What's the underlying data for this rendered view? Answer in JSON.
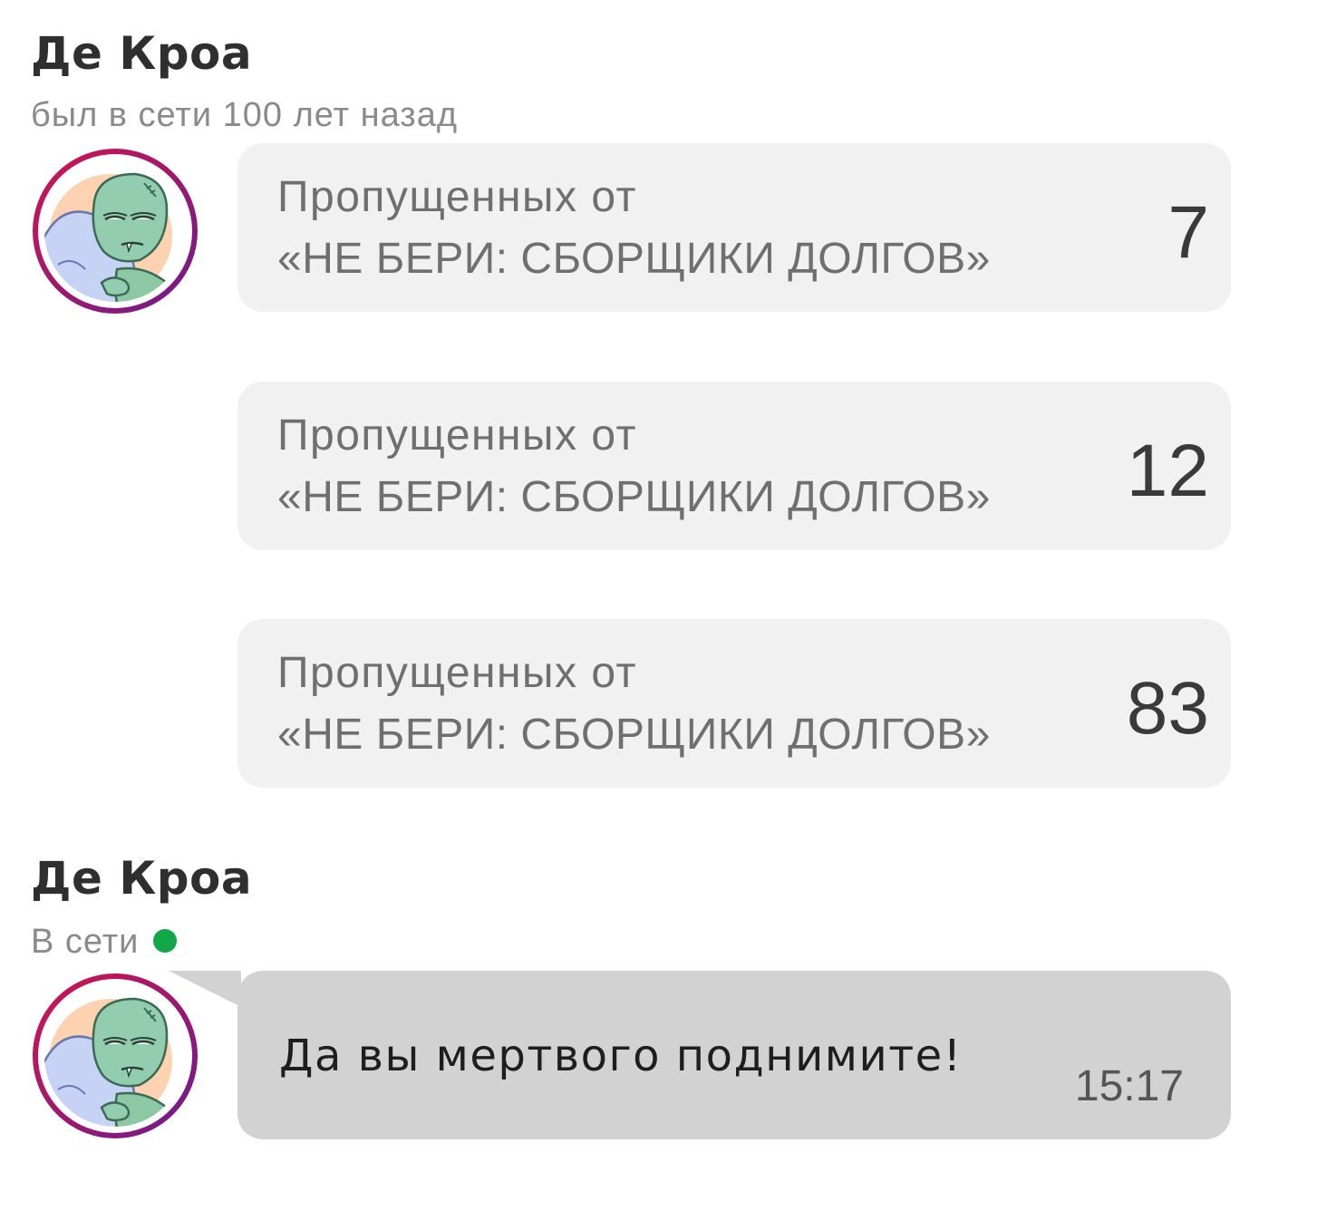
{
  "top_contact": {
    "name": "Де Кроа",
    "status": "был в сети 100 лет назад"
  },
  "missed_cards": [
    {
      "line1": "Пропущенных от",
      "line2": "«НЕ БЕРИ: СБОРЩИКИ ДОЛГОВ»",
      "count": "7"
    },
    {
      "line1": "Пропущенных от",
      "line2": "«НЕ БЕРИ: СБОРЩИКИ ДОЛГОВ»",
      "count": "12"
    },
    {
      "line1": "Пропущенных от",
      "line2": "«НЕ БЕРИ: СБОРЩИКИ ДОЛГОВ»",
      "count": "83"
    }
  ],
  "bottom_contact": {
    "name": "Де Кроа",
    "status": "В сети",
    "online_color": "#12a84a"
  },
  "message": {
    "text": "Да вы мертвого поднимите!",
    "time": "15:17"
  },
  "avatar": {
    "icon": "sleepy-zombie-hugging-pillow-avatar",
    "ring_colors": [
      "#c0155a",
      "#7a1a8a"
    ]
  }
}
